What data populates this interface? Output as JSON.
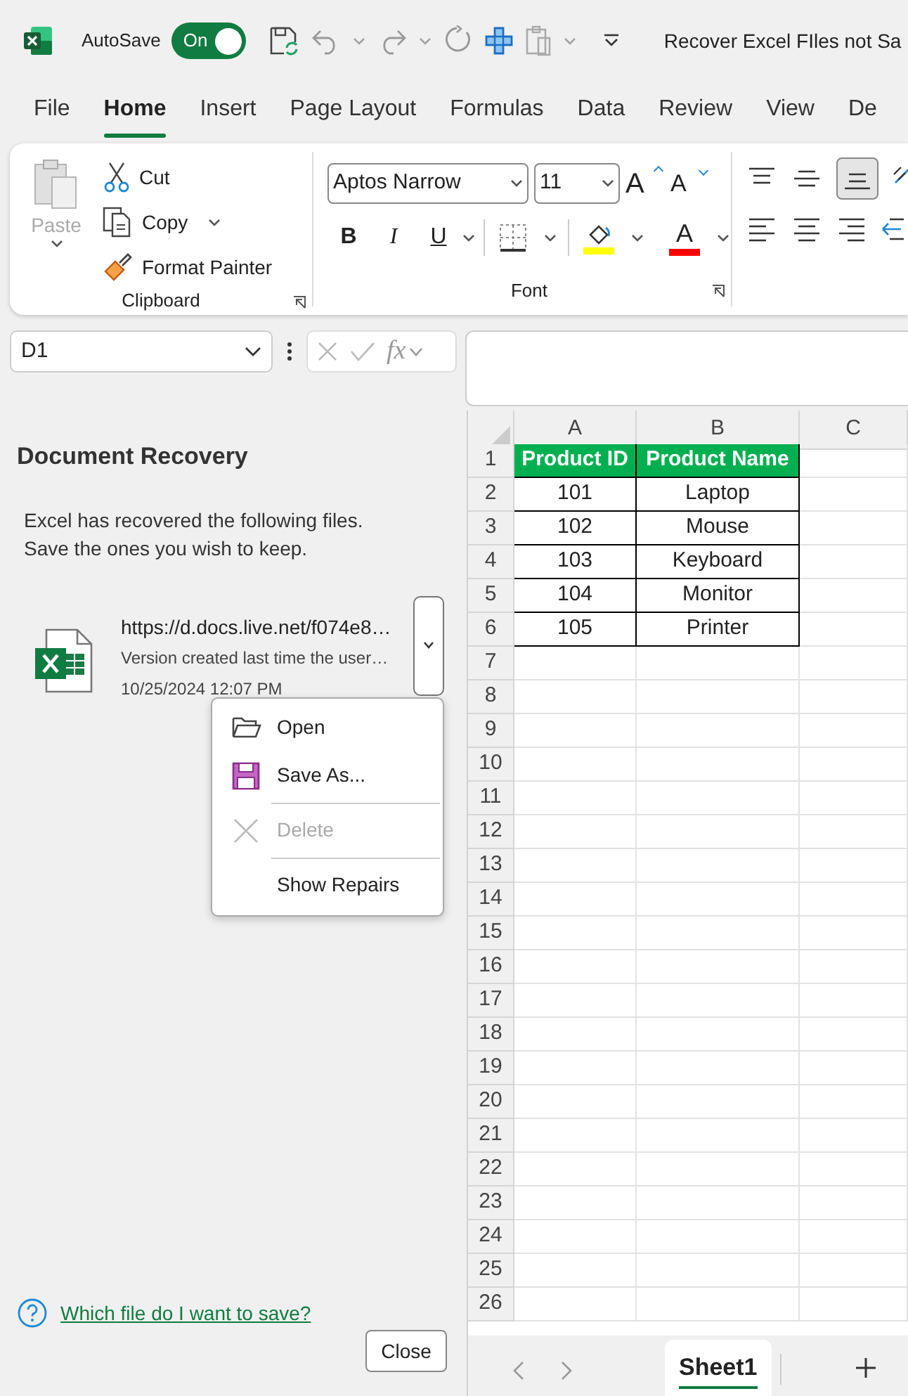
{
  "title_bar": {
    "autosave_label": "AutoSave",
    "autosave": {
      "label": "On",
      "on": true
    },
    "document_title": "Recover Excel FIles not Sa"
  },
  "ribbon_tabs": [
    {
      "label": "File",
      "selected": false
    },
    {
      "label": "Home",
      "selected": true
    },
    {
      "label": "Insert",
      "selected": false
    },
    {
      "label": "Page Layout",
      "selected": false
    },
    {
      "label": "Formulas",
      "selected": false
    },
    {
      "label": "Data",
      "selected": false
    },
    {
      "label": "Review",
      "selected": false
    },
    {
      "label": "View",
      "selected": false
    },
    {
      "label": "De",
      "selected": false
    }
  ],
  "ribbon": {
    "clipboard": {
      "paste": {
        "label": "Paste",
        "disabled": true
      },
      "cut": "Cut",
      "copy": "Copy",
      "format_painter": "Format Painter",
      "group_label": "Clipboard"
    },
    "font": {
      "font_name": "Aptos Narrow",
      "font_size": "11",
      "grow_font": "A",
      "shrink_font": "A",
      "bold": "B",
      "italic": "I",
      "underline": "U",
      "font_color": "A",
      "group_label": "Font"
    }
  },
  "name_box": "D1",
  "formula_bar": {
    "function_glyph": "fx"
  },
  "recovery_pane": {
    "title": "Document Recovery",
    "message": "Excel has recovered the following files.\nSave the ones you wish to keep.",
    "files": [
      {
        "name": "https://d.docs.live.net/f074e8…",
        "description": "Version created last time the user…",
        "timestamp": "10/25/2024 12:07 PM",
        "menu_open": true
      }
    ],
    "file_menu": [
      {
        "kind": "open",
        "label": "Open",
        "disabled": false,
        "separator_before": false
      },
      {
        "kind": "save",
        "label": "Save As...",
        "disabled": false,
        "separator_before": false
      },
      {
        "kind": "delete",
        "label": "Delete",
        "disabled": true,
        "separator_before": true
      },
      {
        "kind": "plain",
        "label": "Show Repairs",
        "disabled": false,
        "separator_before": true
      }
    ],
    "help_link": "Which file do I want to save?",
    "close_button": "Close"
  },
  "sheet": {
    "columns": [
      "A",
      "B",
      "C"
    ],
    "row_numbers": [
      "1",
      "2",
      "3",
      "4",
      "5",
      "6",
      "7",
      "8",
      "9",
      "10",
      "11",
      "12",
      "13",
      "14",
      "15",
      "16",
      "17",
      "18",
      "19",
      "20",
      "21",
      "22",
      "23",
      "24",
      "25",
      "26"
    ],
    "table": {
      "header": [
        "Product ID",
        "Product Name"
      ],
      "rows": [
        [
          "101",
          "Laptop"
        ],
        [
          "102",
          "Mouse"
        ],
        [
          "103",
          "Keyboard"
        ],
        [
          "104",
          "Monitor"
        ],
        [
          "105",
          "Printer"
        ]
      ]
    }
  },
  "sheet_tabs": [
    {
      "label": "Sheet1",
      "selected": true
    }
  ]
}
